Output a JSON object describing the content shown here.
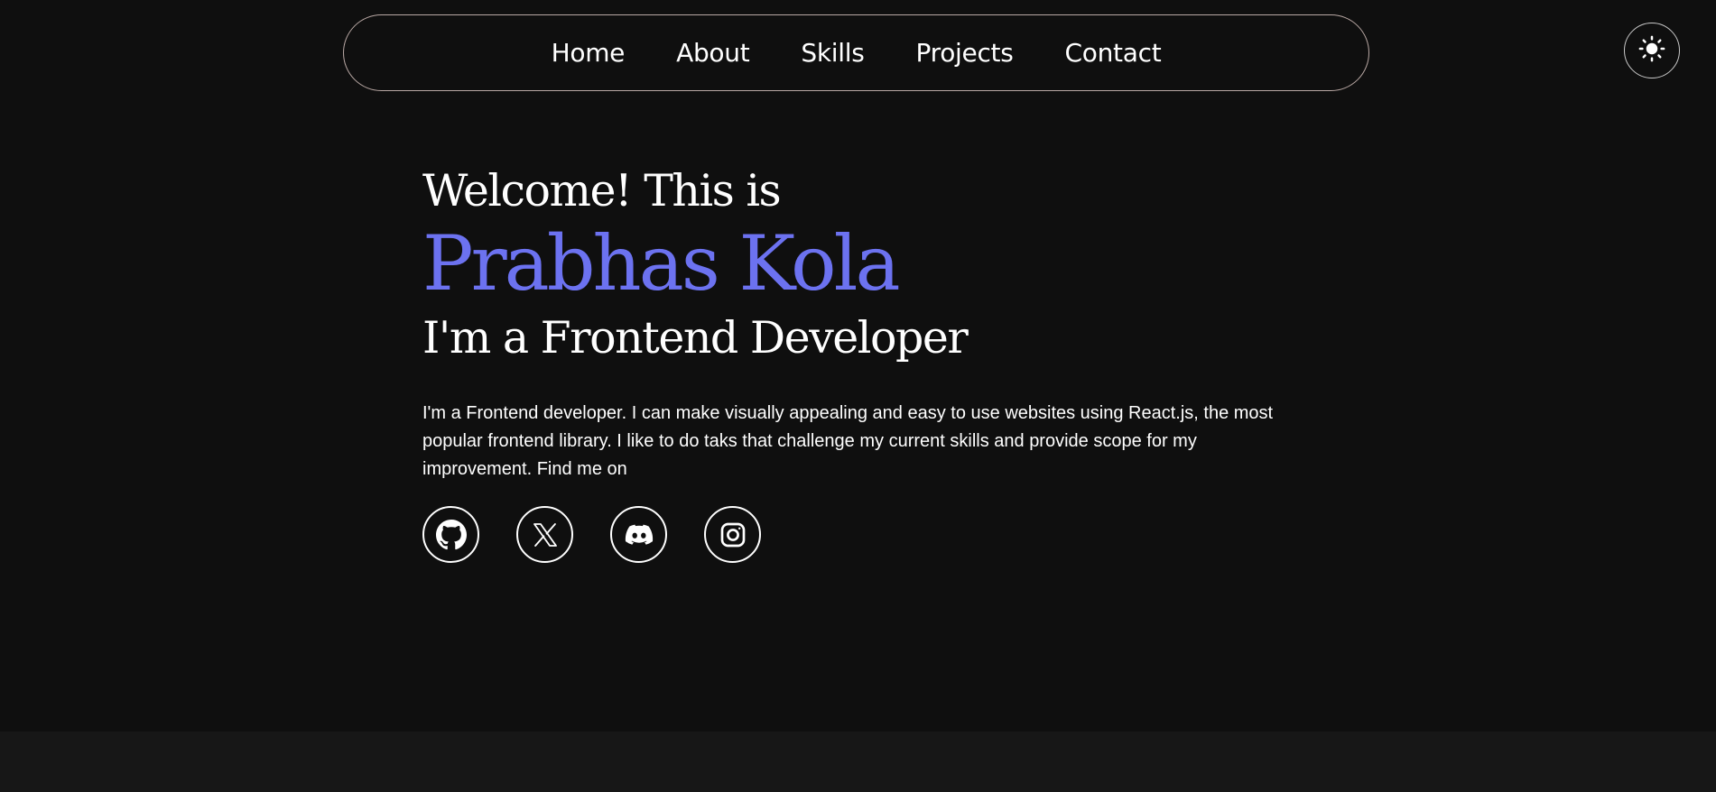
{
  "nav": {
    "items": [
      {
        "label": "Home"
      },
      {
        "label": "About"
      },
      {
        "label": "Skills"
      },
      {
        "label": "Projects"
      },
      {
        "label": "Contact"
      }
    ]
  },
  "theme_toggle": {
    "icon": "sun-icon"
  },
  "hero": {
    "greeting": "Welcome! This is",
    "name": "Prabhas Kola",
    "role": "I'm a Frontend Developer",
    "bio": "I'm a Frontend developer. I can make visually appealing and easy to use websites using React.js, the most popular frontend library. I like to do taks that challenge my current skills and provide scope for my improvement. Find me on"
  },
  "socials": [
    {
      "icon": "github-icon"
    },
    {
      "icon": "x-twitter-icon"
    },
    {
      "icon": "discord-icon"
    },
    {
      "icon": "instagram-icon"
    }
  ],
  "colors": {
    "background": "#0f0f0f",
    "accent": "#6c72f0",
    "text": "#ffffff",
    "nav_border": "#b9a8a4",
    "next_section": "#171717"
  }
}
